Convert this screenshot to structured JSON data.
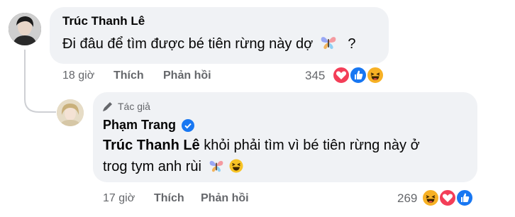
{
  "comment1": {
    "author": "Trúc Thanh Lê",
    "text": "Đi đâu để tìm được bé tiên rừng này dợ",
    "text_suffix": "?",
    "time": "18 giờ",
    "like_label": "Thích",
    "reply_label": "Phản hồi",
    "reaction_count": "345",
    "reactions": [
      "love-icon",
      "like-icon",
      "haha-icon"
    ]
  },
  "comment2": {
    "author_badge": "Tác giả",
    "author": "Phạm Trang",
    "mention": "Trúc Thanh Lê",
    "text_line1": "khỏi phải tìm vì bé tiên rừng này ở",
    "text_line2": "trog tym anh rùi",
    "time": "17 giờ",
    "like_label": "Thích",
    "reply_label": "Phản hồi",
    "reaction_count": "269",
    "reactions": [
      "haha-icon",
      "love-icon",
      "like-icon"
    ]
  },
  "colors": {
    "bubble": "#f0f2f5",
    "meta_text": "#65676b",
    "like_blue": "#1877f2",
    "love_red": "#f33e58",
    "haha_yellow": "#f7b125"
  }
}
